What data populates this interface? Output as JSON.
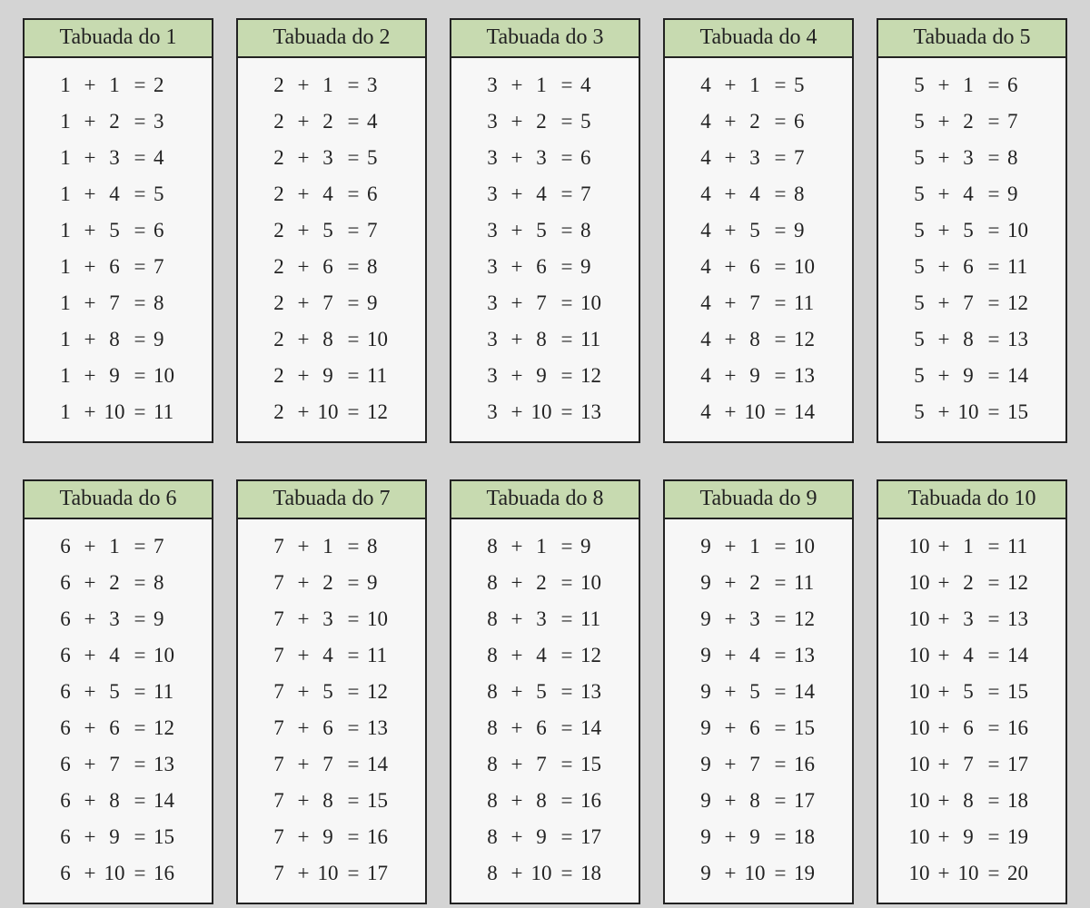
{
  "title_prefix": "Tabuada do ",
  "op": "+",
  "eq": "=",
  "tables": [
    {
      "n": 1,
      "rows": [
        [
          1,
          1,
          2
        ],
        [
          1,
          2,
          3
        ],
        [
          1,
          3,
          4
        ],
        [
          1,
          4,
          5
        ],
        [
          1,
          5,
          6
        ],
        [
          1,
          6,
          7
        ],
        [
          1,
          7,
          8
        ],
        [
          1,
          8,
          9
        ],
        [
          1,
          9,
          10
        ],
        [
          1,
          10,
          11
        ]
      ]
    },
    {
      "n": 2,
      "rows": [
        [
          2,
          1,
          3
        ],
        [
          2,
          2,
          4
        ],
        [
          2,
          3,
          5
        ],
        [
          2,
          4,
          6
        ],
        [
          2,
          5,
          7
        ],
        [
          2,
          6,
          8
        ],
        [
          2,
          7,
          9
        ],
        [
          2,
          8,
          10
        ],
        [
          2,
          9,
          11
        ],
        [
          2,
          10,
          12
        ]
      ]
    },
    {
      "n": 3,
      "rows": [
        [
          3,
          1,
          4
        ],
        [
          3,
          2,
          5
        ],
        [
          3,
          3,
          6
        ],
        [
          3,
          4,
          7
        ],
        [
          3,
          5,
          8
        ],
        [
          3,
          6,
          9
        ],
        [
          3,
          7,
          10
        ],
        [
          3,
          8,
          11
        ],
        [
          3,
          9,
          12
        ],
        [
          3,
          10,
          13
        ]
      ]
    },
    {
      "n": 4,
      "rows": [
        [
          4,
          1,
          5
        ],
        [
          4,
          2,
          6
        ],
        [
          4,
          3,
          7
        ],
        [
          4,
          4,
          8
        ],
        [
          4,
          5,
          9
        ],
        [
          4,
          6,
          10
        ],
        [
          4,
          7,
          11
        ],
        [
          4,
          8,
          12
        ],
        [
          4,
          9,
          13
        ],
        [
          4,
          10,
          14
        ]
      ]
    },
    {
      "n": 5,
      "rows": [
        [
          5,
          1,
          6
        ],
        [
          5,
          2,
          7
        ],
        [
          5,
          3,
          8
        ],
        [
          5,
          4,
          9
        ],
        [
          5,
          5,
          10
        ],
        [
          5,
          6,
          11
        ],
        [
          5,
          7,
          12
        ],
        [
          5,
          8,
          13
        ],
        [
          5,
          9,
          14
        ],
        [
          5,
          10,
          15
        ]
      ]
    },
    {
      "n": 6,
      "rows": [
        [
          6,
          1,
          7
        ],
        [
          6,
          2,
          8
        ],
        [
          6,
          3,
          9
        ],
        [
          6,
          4,
          10
        ],
        [
          6,
          5,
          11
        ],
        [
          6,
          6,
          12
        ],
        [
          6,
          7,
          13
        ],
        [
          6,
          8,
          14
        ],
        [
          6,
          9,
          15
        ],
        [
          6,
          10,
          16
        ]
      ]
    },
    {
      "n": 7,
      "rows": [
        [
          7,
          1,
          8
        ],
        [
          7,
          2,
          9
        ],
        [
          7,
          3,
          10
        ],
        [
          7,
          4,
          11
        ],
        [
          7,
          5,
          12
        ],
        [
          7,
          6,
          13
        ],
        [
          7,
          7,
          14
        ],
        [
          7,
          8,
          15
        ],
        [
          7,
          9,
          16
        ],
        [
          7,
          10,
          17
        ]
      ]
    },
    {
      "n": 8,
      "rows": [
        [
          8,
          1,
          9
        ],
        [
          8,
          2,
          10
        ],
        [
          8,
          3,
          11
        ],
        [
          8,
          4,
          12
        ],
        [
          8,
          5,
          13
        ],
        [
          8,
          6,
          14
        ],
        [
          8,
          7,
          15
        ],
        [
          8,
          8,
          16
        ],
        [
          8,
          9,
          17
        ],
        [
          8,
          10,
          18
        ]
      ]
    },
    {
      "n": 9,
      "rows": [
        [
          9,
          1,
          10
        ],
        [
          9,
          2,
          11
        ],
        [
          9,
          3,
          12
        ],
        [
          9,
          4,
          13
        ],
        [
          9,
          5,
          14
        ],
        [
          9,
          6,
          15
        ],
        [
          9,
          7,
          16
        ],
        [
          9,
          8,
          17
        ],
        [
          9,
          9,
          18
        ],
        [
          9,
          10,
          19
        ]
      ]
    },
    {
      "n": 10,
      "rows": [
        [
          10,
          1,
          11
        ],
        [
          10,
          2,
          12
        ],
        [
          10,
          3,
          13
        ],
        [
          10,
          4,
          14
        ],
        [
          10,
          5,
          15
        ],
        [
          10,
          6,
          16
        ],
        [
          10,
          7,
          17
        ],
        [
          10,
          8,
          18
        ],
        [
          10,
          9,
          19
        ],
        [
          10,
          10,
          20
        ]
      ]
    }
  ]
}
